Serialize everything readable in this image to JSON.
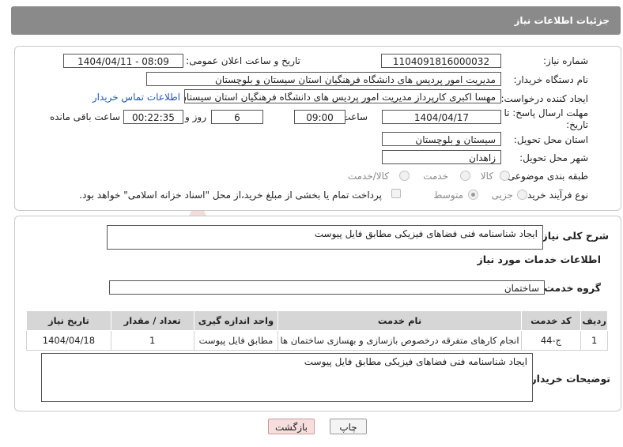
{
  "header": {
    "title": "جزئیات اطلاعات نیاز"
  },
  "form": {
    "need_number_label": "شماره نیاز:",
    "need_number": "1104091816000032",
    "announce_label": "تاریخ و ساعت اعلان عمومی:",
    "announce_value": "1404/04/11 - 08:09",
    "buyer_org_label": "نام دستگاه خریدار:",
    "buyer_org": "مدیریت امور پردیس های دانشگاه فرهنگیان استان سیستان و بلوچستان",
    "requester_label": "ایجاد کننده درخواست:",
    "requester": "مهسا اکبری کارپرداز مدیریت امور پردیس های دانشگاه فرهنگیان استان سیستان",
    "contact_link": "اطلاعات تماس خریدار",
    "deadline_label_1": "مهلت ارسال پاسخ: تا",
    "deadline_label_2": "تاریخ:",
    "deadline_date": "1404/04/17",
    "time_label": "ساعت",
    "deadline_time": "09:00",
    "days_value": "6",
    "days_label": "روز و",
    "remaining_time": "00:22:35",
    "remaining_label": "ساعت باقی مانده",
    "province_label": "استان محل تحویل:",
    "province": "سیستان و بلوچستان",
    "city_label": "شهر محل تحویل:",
    "city": "زاهدان",
    "category_label": "طبقه بندی موضوعی:",
    "category_options": [
      "کالا",
      "خدمت",
      "کالا/خدمت"
    ],
    "process_label": "نوع فرآیند خرید :",
    "process_options": [
      "جزیی",
      "متوسط"
    ],
    "payment_note": "پرداخت تمام یا بخشی از مبلغ خرید،از محل \"اسناد خزانه اسلامی\" خواهد بود."
  },
  "summary": {
    "label": "شرح کلی نیاز:",
    "text": "ایجاد شناسنامه فنی فضاهای فیزیکی مطابق فایل پیوست",
    "services_title": "اطلاعات خدمات مورد نیاز",
    "service_group_label": "گروه خدمت:",
    "service_group": "ساختمان"
  },
  "table": {
    "headers": [
      "ردیف",
      "کد خدمت",
      "نام خدمت",
      "واحد اندازه گیری",
      "تعداد / مقدار",
      "تاریخ نیاز"
    ],
    "rows": [
      [
        "1",
        "ج-44",
        "انجام کارهای متفرقه درخصوص بازسازی و بهسازی ساختمان ها",
        "مطابق فایل پیوست",
        "1",
        "1404/04/18"
      ]
    ]
  },
  "buyer_notes": {
    "label": "توضیحات خریدار:",
    "text": "ایجاد شناسنامه فنی فضاهای فیزیکی مطابق فایل پیوست"
  },
  "buttons": {
    "print": "چاپ",
    "back": "بازگشت"
  },
  "watermark": {
    "text": "AriaTender.net"
  },
  "colors": {
    "header_bg": "#8a8a8a",
    "link": "#1a55c8",
    "back_button_bg": "#f7dede",
    "watermark": "#f0b8b8"
  }
}
